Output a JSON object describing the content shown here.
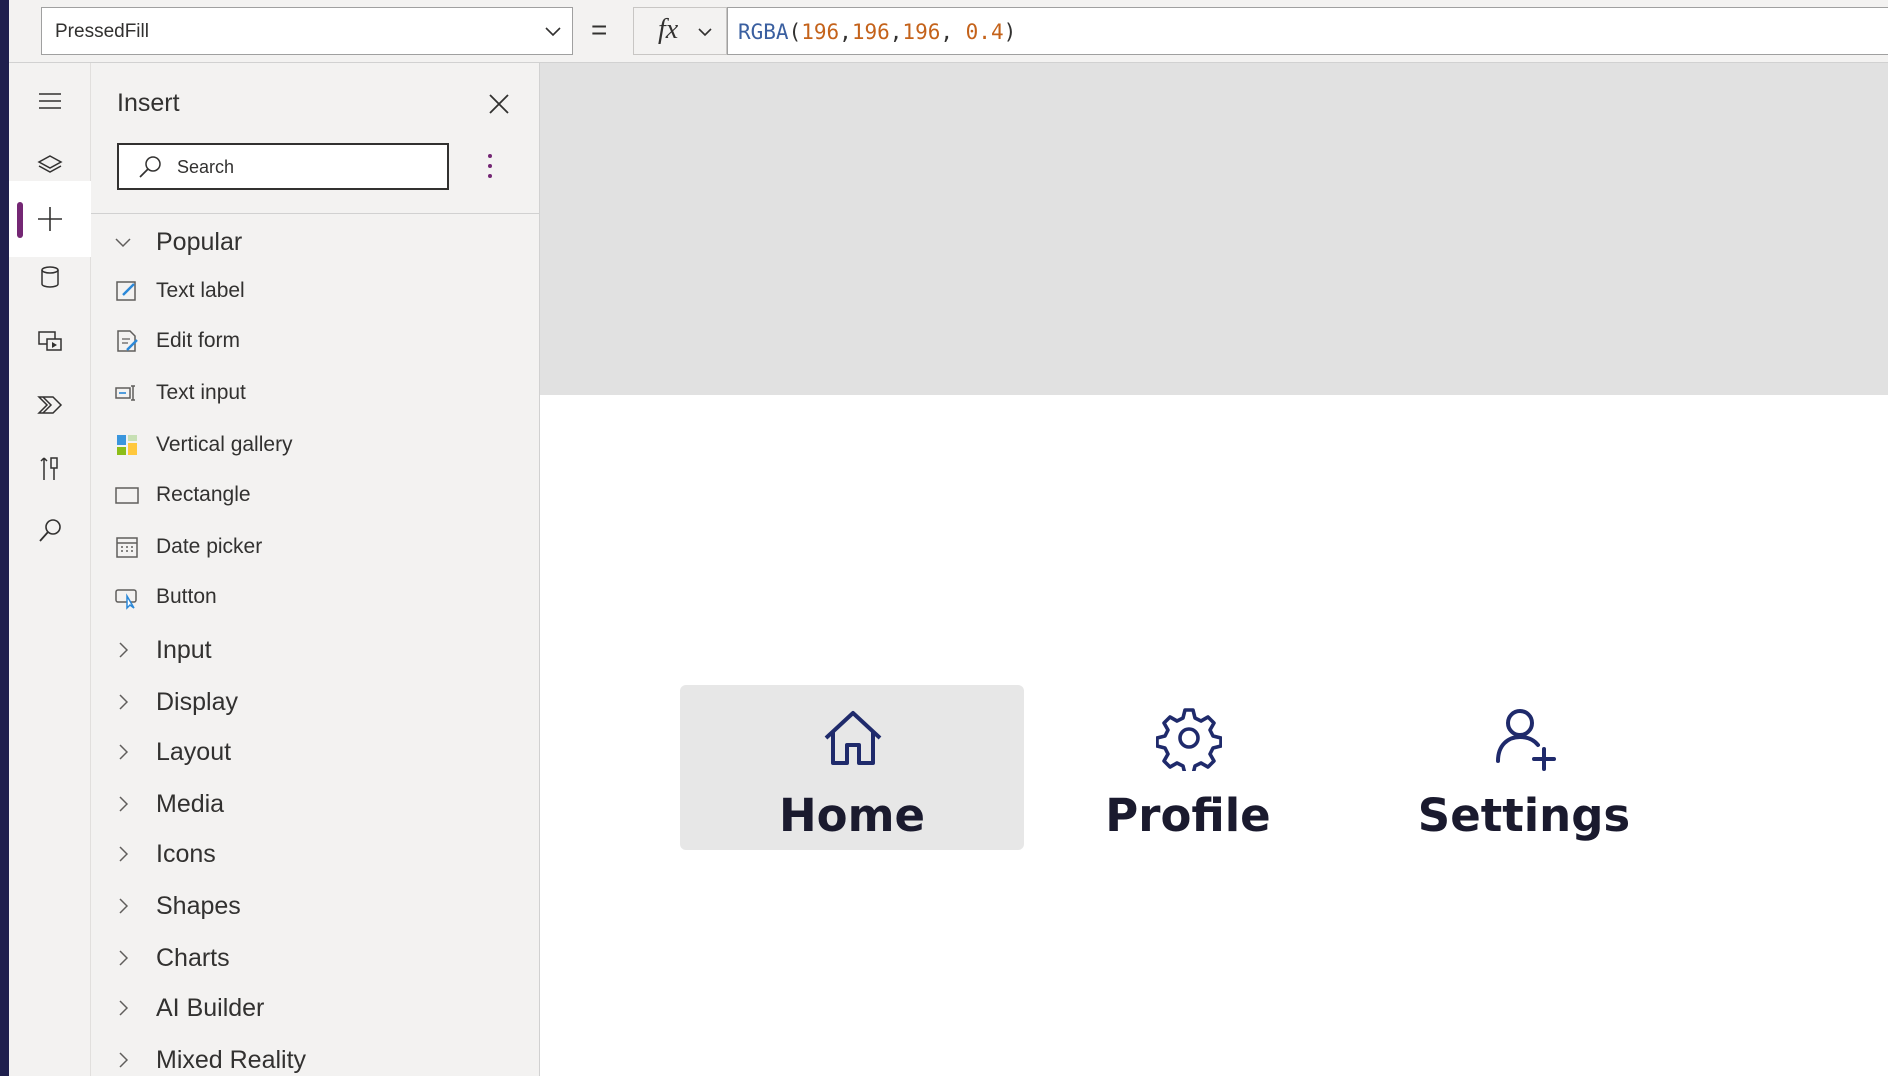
{
  "formula_bar": {
    "property": "PressedFill",
    "equals": "=",
    "fx_label": "fx",
    "formula": {
      "fn": "RGBA",
      "open": "(",
      "r": "196",
      "c1": ",",
      "g": "196",
      "c2": ",",
      "b": "196",
      "c3": ", ",
      "a": "0.4",
      "close": ")"
    }
  },
  "rail": {
    "items": [
      {
        "icon": "hamburger-icon"
      },
      {
        "icon": "layers-icon"
      },
      {
        "icon": "plus-icon",
        "active": true
      },
      {
        "icon": "data-cylinder-icon"
      },
      {
        "icon": "media-icon"
      },
      {
        "icon": "power-automate-icon"
      },
      {
        "icon": "advanced-tools-icon"
      },
      {
        "icon": "search-icon"
      }
    ]
  },
  "insert_pane": {
    "title": "Insert",
    "search_placeholder": "Search",
    "popular": {
      "label": "Popular",
      "items": [
        {
          "label": "Text label",
          "icon": "text-label-icon"
        },
        {
          "label": "Edit form",
          "icon": "edit-form-icon"
        },
        {
          "label": "Text input",
          "icon": "text-input-icon"
        },
        {
          "label": "Vertical gallery",
          "icon": "vertical-gallery-icon"
        },
        {
          "label": "Rectangle",
          "icon": "rectangle-icon"
        },
        {
          "label": "Date picker",
          "icon": "date-picker-icon"
        },
        {
          "label": "Button",
          "icon": "button-icon"
        }
      ]
    },
    "categories": [
      "Input",
      "Display",
      "Layout",
      "Media",
      "Icons",
      "Shapes",
      "Charts",
      "AI Builder",
      "Mixed Reality"
    ]
  },
  "canvas": {
    "nav": [
      {
        "label": "Home",
        "icon": "home-icon",
        "pressed": true
      },
      {
        "label": "Profile",
        "icon": "gear-icon",
        "pressed": false
      },
      {
        "label": "Settings",
        "icon": "add-person-icon",
        "pressed": false
      }
    ],
    "pressed_fill": "#c4c4c466",
    "top_band_color": "#e1e1e1"
  }
}
